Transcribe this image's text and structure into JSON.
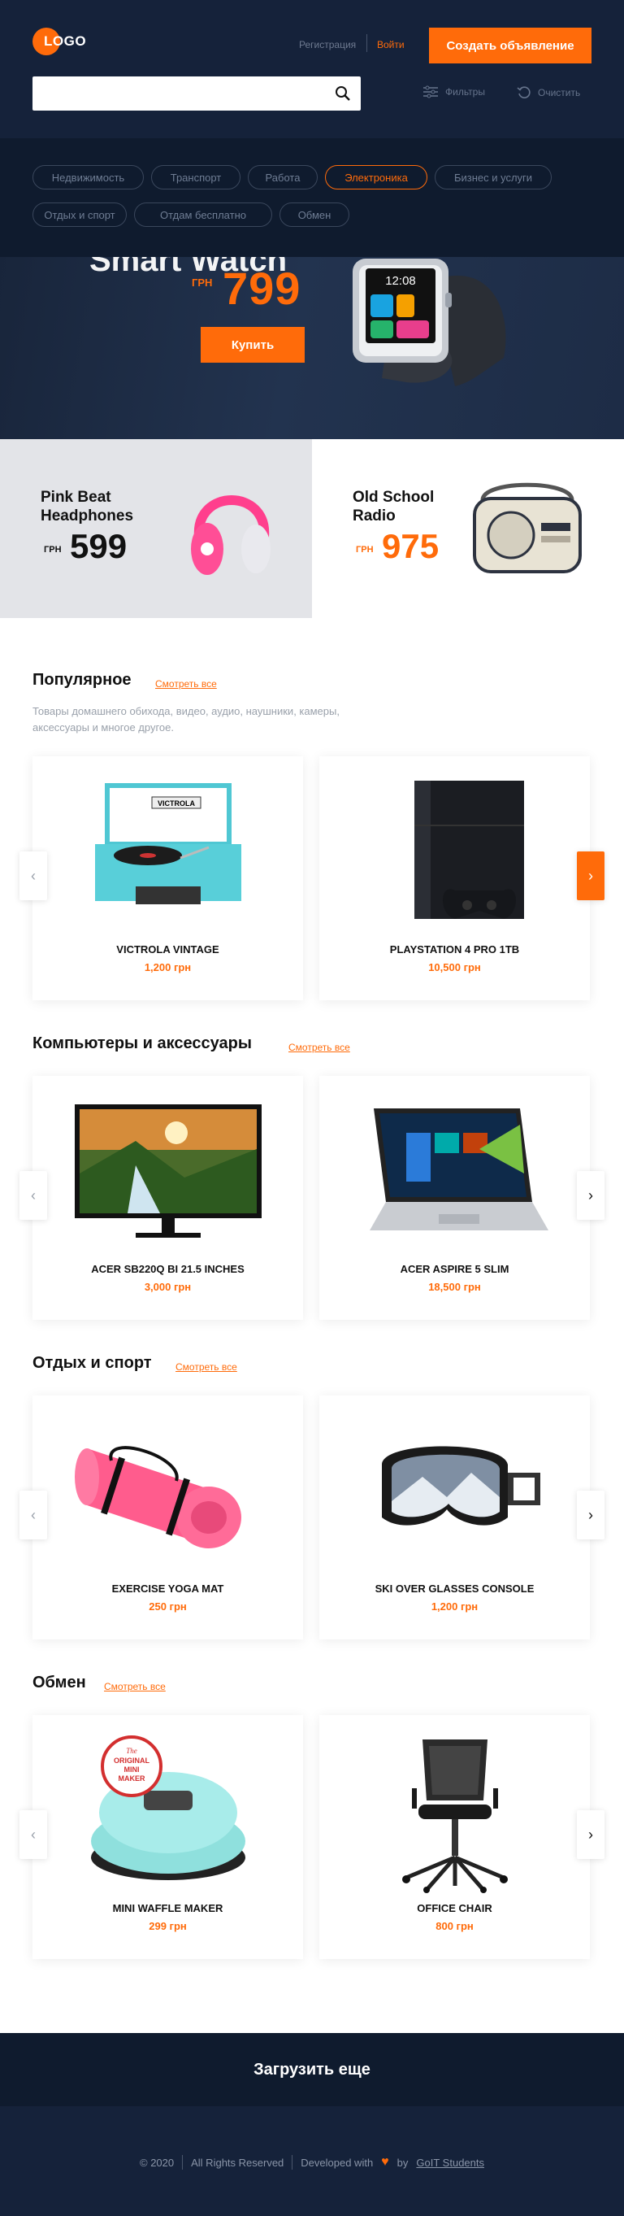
{
  "header": {
    "logo": "LOGO",
    "register": "Регистрация",
    "login": "Войти",
    "create": "Создать объявление",
    "search_placeholder": "",
    "filters": "Фильтры",
    "clear": "Очистить"
  },
  "categories": [
    "Недвижимость",
    "Транспорт",
    "Работа",
    "Электроника",
    "Бизнес и услуги",
    "Отдых и спорт",
    "Отдам бесплатно",
    "Обмен"
  ],
  "active_category": "Электроника",
  "hero": {
    "title": "Smart Watch",
    "currency": "ГРН",
    "price": "799",
    "buy": "Купить",
    "watch_time": "12:08"
  },
  "promos": [
    {
      "title_l1": "Pink Beat",
      "title_l2": "Headphones",
      "currency": "ГРН",
      "price": "599"
    },
    {
      "title_l1": "Old School",
      "title_l2": "Radio",
      "currency": "ГРН",
      "price": "975"
    }
  ],
  "sections": [
    {
      "title": "Популярное",
      "see_all": "Смотреть все",
      "desc": "Товары домашнего обихода, видео, аудио, наушники, камеры, аксессуары и многое другое.",
      "items": [
        {
          "name": "VICTROLA VINTAGE",
          "price": "1,200 грн"
        },
        {
          "name": "PLAYSTATION 4 PRO 1TB",
          "price": "10,500 грн"
        }
      ]
    },
    {
      "title": "Компьютеры и аксессуары",
      "see_all": "Смотреть все",
      "items": [
        {
          "name": "ACER SB220Q BI 21.5 INCHES",
          "price": "3,000 грн"
        },
        {
          "name": "ACER ASPIRE 5 SLIM",
          "price": "18,500 грн"
        }
      ]
    },
    {
      "title": "Отдых и спорт",
      "see_all": "Смотреть все",
      "items": [
        {
          "name": "EXERCISE YOGA MAT",
          "price": "250 грн"
        },
        {
          "name": "SKI OVER GLASSES CONSOLE",
          "price": "1,200 грн"
        }
      ]
    },
    {
      "title": "Обмен",
      "see_all": "Смотреть все",
      "items": [
        {
          "name": "MINI WAFFLE MAKER",
          "price": "299 грн"
        },
        {
          "name": "OFFICE CHAIR",
          "price": "800 грн"
        }
      ]
    }
  ],
  "product_text": {
    "victrola_brand": "VICTROLA",
    "waffle_l1": "The",
    "waffle_l2": "ORIGINAL",
    "waffle_l3": "MINI",
    "waffle_l4": "MAKER"
  },
  "load_more": "Загрузить еще",
  "footer": {
    "copyright": "© 2020",
    "rights": "All Rights Reserved",
    "developed": "Developed with",
    "by": "by",
    "author": "GoIT Students"
  },
  "colors": {
    "accent": "#ff6b0a",
    "dark": "#15223a",
    "darker": "#0f1b2e"
  }
}
